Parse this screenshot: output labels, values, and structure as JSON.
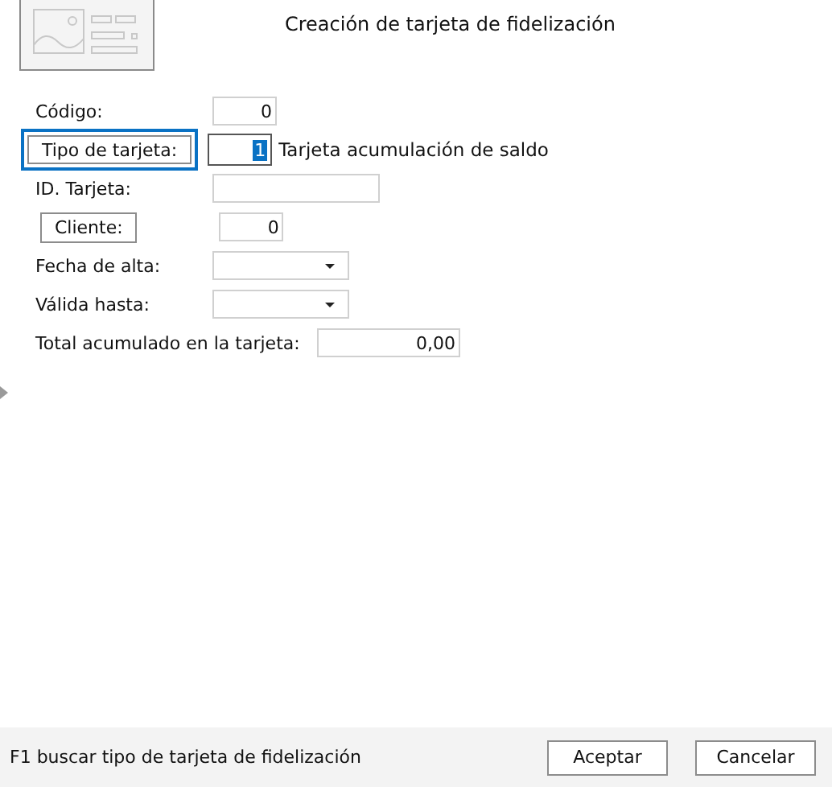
{
  "window": {
    "title": "Creación de tarjeta de fidelización"
  },
  "form": {
    "rows": [
      {
        "kind": "text",
        "label": "Código:",
        "value": "0"
      },
      {
        "kind": "button",
        "label": "Tipo de tarjeta:",
        "focused": true,
        "value": "1",
        "value_selected": true,
        "description": "Tarjeta acumulación de saldo"
      },
      {
        "kind": "text-wide",
        "label": "ID. Tarjeta:"
      },
      {
        "kind": "button",
        "label": "Cliente:",
        "focused": false,
        "value": "0",
        "value_selected": false
      },
      {
        "kind": "dropdown",
        "label": "Fecha de alta:"
      },
      {
        "kind": "dropdown",
        "label": "Válida hasta:"
      },
      {
        "kind": "total",
        "label": "Total acumulado en la tarjeta:",
        "value": "0,00"
      }
    ]
  },
  "status_bar": {
    "hint": "F1 buscar tipo de tarjeta de fidelización",
    "buttons": [
      "Aceptar",
      "Cancelar"
    ]
  }
}
